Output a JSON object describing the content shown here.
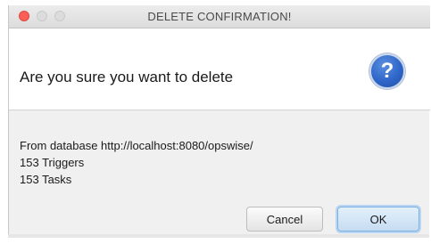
{
  "window": {
    "title": "DELETE CONFIRMATION!"
  },
  "header": {
    "text": "Are you sure you want to delete",
    "icon": "question-icon",
    "icon_glyph": "?",
    "icon_color": "#2f66c9"
  },
  "message": {
    "lines": [
      "From database http://localhost:8080/opswise/",
      "153 Triggers",
      "153 Tasks"
    ]
  },
  "buttons": {
    "cancel_label": "Cancel",
    "ok_label": "OK"
  },
  "colors": {
    "close_button": "#fc5f57",
    "default_button_border": "#7fb1e0"
  }
}
